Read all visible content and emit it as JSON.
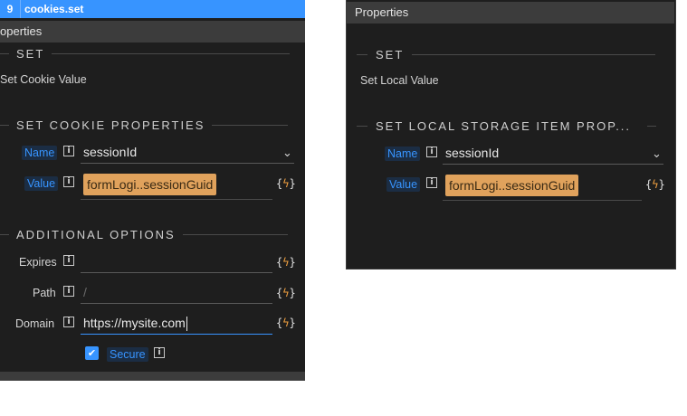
{
  "left": {
    "step": {
      "number": "9",
      "name": "cookies.set"
    },
    "header": "operties",
    "set_section": "SET",
    "set_description": "Set Cookie Value",
    "cookie_section": "SET COOKIE PROPERTIES",
    "fields": {
      "name_label": "Name",
      "name_value": "sessionId",
      "value_label": "Value",
      "value_chip": "formLogi..sessionGuid"
    },
    "additional_section": "ADDITIONAL OPTIONS",
    "options": {
      "expires_label": "Expires",
      "expires_value": "",
      "path_label": "Path",
      "path_placeholder": "/",
      "domain_label": "Domain",
      "domain_value": "https://mysite.com",
      "secure_label": "Secure"
    }
  },
  "right": {
    "header": "Properties",
    "set_section": "SET",
    "set_description": "Set Local Value",
    "storage_section": "SET LOCAL STORAGE ITEM PROP...",
    "fields": {
      "name_label": "Name",
      "name_value": "sessionId",
      "value_label": "Value",
      "value_chip": "formLogi..sessionGuid"
    }
  },
  "icons": {
    "info": "info-icon",
    "expression": "expression-bolt-icon",
    "chevron": "chevron-down-icon",
    "check": "checkmark-icon"
  },
  "colors": {
    "accent": "#3794ff",
    "chip": "#e0a25c",
    "panel": "#1e1e1e"
  }
}
